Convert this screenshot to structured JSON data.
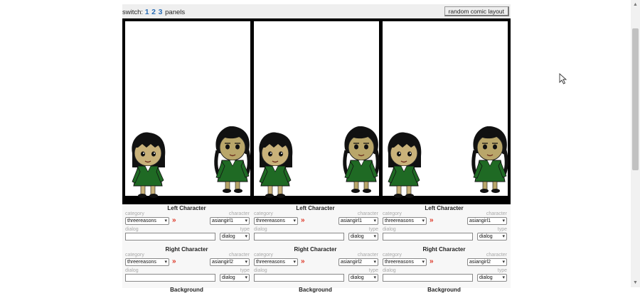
{
  "topbar": {
    "switch_prefix": "switch:",
    "panel_options": [
      "1",
      "2",
      "3"
    ],
    "switch_suffix": "panels",
    "random_button": "random comic layout"
  },
  "labels": {
    "left_character": "Left Character",
    "right_character": "Right Character",
    "background": "Background",
    "category": "category",
    "character": "character",
    "dialog": "dialog",
    "type": "type",
    "next": "»"
  },
  "panels": [
    {
      "left": {
        "category": "threereasons",
        "character": "asiangirl1",
        "dialog": "",
        "type": "dialog"
      },
      "right": {
        "category": "threereasons",
        "character": "asiangirl2",
        "dialog": "",
        "type": "dialog"
      }
    },
    {
      "left": {
        "category": "threereasons",
        "character": "asiangirl1",
        "dialog": "",
        "type": "dialog"
      },
      "right": {
        "category": "threereasons",
        "character": "asiangirl2",
        "dialog": "",
        "type": "dialog"
      }
    },
    {
      "left": {
        "category": "threereasons",
        "character": "asiangirl1",
        "dialog": "",
        "type": "dialog"
      },
      "right": {
        "category": "threereasons",
        "character": "asiangirl2",
        "dialog": "",
        "type": "dialog"
      }
    }
  ],
  "icons": {
    "scroll_up": "chevron-up-icon",
    "scroll_down": "chevron-down-icon",
    "cursor": "mouse-pointer-icon",
    "next": "double-chevron-right-icon"
  },
  "colors": {
    "link": "#2a6db5",
    "next_arrows": "#dd3322",
    "character_uniform": "#1f6a24",
    "comic_frame": "#000000"
  }
}
